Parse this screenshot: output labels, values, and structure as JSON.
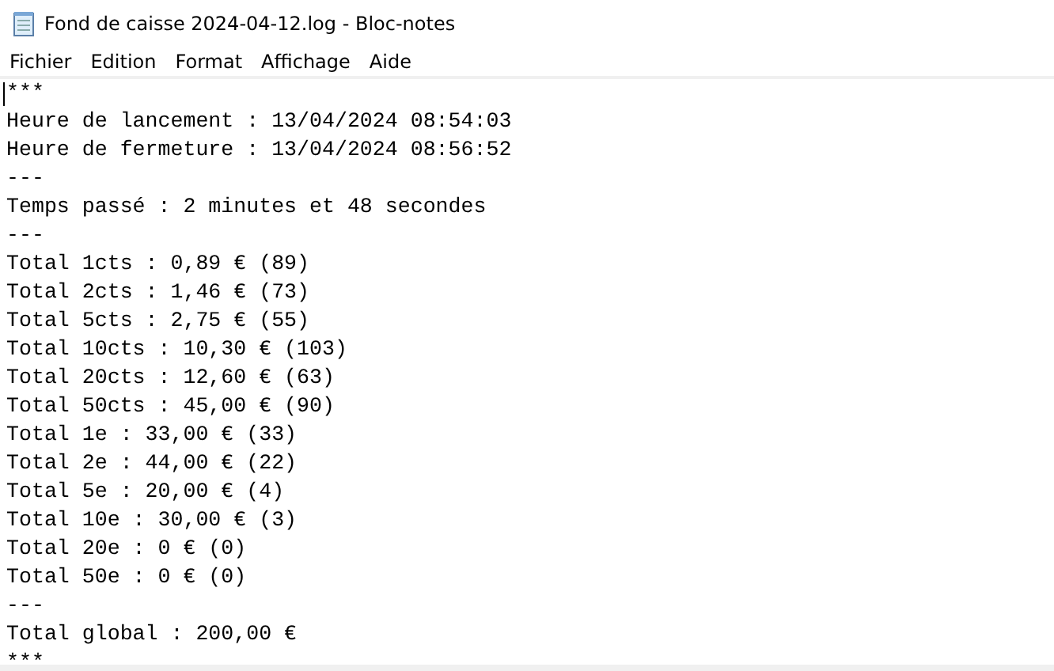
{
  "window": {
    "title": "Fond de caisse 2024-04-12.log - Bloc-notes"
  },
  "menu": [
    "Fichier",
    "Edition",
    "Format",
    "Affichage",
    "Aide"
  ],
  "editor": {
    "lines": [
      "***",
      "Heure de lancement : 13/04/2024 08:54:03",
      "Heure de fermeture : 13/04/2024 08:56:52",
      "---",
      "Temps passé : 2 minutes et 48 secondes",
      "---",
      "Total 1cts : 0,89 € (89)",
      "Total 2cts : 1,46 € (73)",
      "Total 5cts : 2,75 € (55)",
      "Total 10cts : 10,30 € (103)",
      "Total 20cts : 12,60 € (63)",
      "Total 50cts : 45,00 € (90)",
      "Total 1e : 33,00 € (33)",
      "Total 2e : 44,00 € (22)",
      "Total 5e : 20,00 € (4)",
      "Total 10e : 30,00 € (3)",
      "Total 20e : 0 € (0)",
      "Total 50e : 0 € (0)",
      "---",
      "Total global : 200,00 €",
      "***"
    ]
  }
}
